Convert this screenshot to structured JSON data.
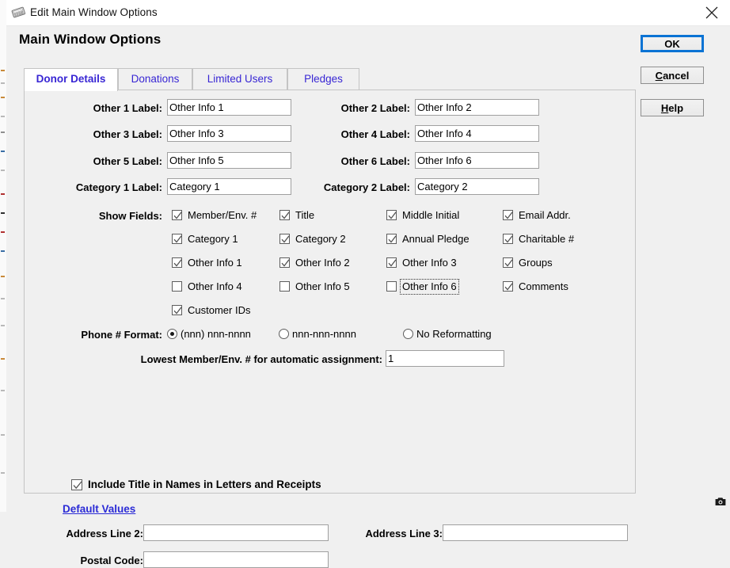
{
  "window": {
    "title": "Edit Main Window Options",
    "icon": "application-icon",
    "close_label": "✕"
  },
  "page_title": "Main Window Options",
  "buttons": [
    {
      "name": "ok-button",
      "label": "OK",
      "mnemonic": "",
      "focused": true
    },
    {
      "name": "cancel-button",
      "label": "Cancel",
      "mnemonic": "C",
      "focused": false
    },
    {
      "name": "help-button",
      "label": "Help",
      "mnemonic": "H",
      "focused": false
    }
  ],
  "tabs": [
    {
      "label": "Donor Details",
      "active": true
    },
    {
      "label": "Donations",
      "active": false
    },
    {
      "label": "Limited Users",
      "active": false
    },
    {
      "label": "Pledges",
      "active": false
    }
  ],
  "label_fields": [
    {
      "label": "Other 1 Label:",
      "value": "Other Info 1",
      "column": "left"
    },
    {
      "label": "Other 2 Label:",
      "value": "Other Info 2",
      "column": "right"
    },
    {
      "label": "Other 3 Label:",
      "value": "Other Info 3",
      "column": "left"
    },
    {
      "label": "Other 4 Label:",
      "value": "Other Info 4",
      "column": "right"
    },
    {
      "label": "Other 5 Label:",
      "value": "Other Info 5",
      "column": "left"
    },
    {
      "label": "Other 6 Label:",
      "value": "Other Info 6",
      "column": "right"
    },
    {
      "label": "Category 1 Label:",
      "value": "Category 1",
      "column": "left"
    },
    {
      "label": "Category 2 Label:",
      "value": "Category 2",
      "column": "right"
    }
  ],
  "show_fields": {
    "label": "Show Fields:",
    "items": [
      {
        "label": "Member/Env. #",
        "checked": true,
        "focused": false
      },
      {
        "label": "Title",
        "checked": true,
        "focused": false
      },
      {
        "label": "Middle Initial",
        "checked": true,
        "focused": false
      },
      {
        "label": "Email Addr.",
        "checked": true,
        "focused": false
      },
      {
        "label": "Category 1",
        "checked": true,
        "focused": false
      },
      {
        "label": "Category 2",
        "checked": true,
        "focused": false
      },
      {
        "label": "Annual Pledge",
        "checked": true,
        "focused": false
      },
      {
        "label": "Charitable #",
        "checked": true,
        "focused": false
      },
      {
        "label": "Other Info 1",
        "checked": true,
        "focused": false
      },
      {
        "label": "Other Info 2",
        "checked": true,
        "focused": false
      },
      {
        "label": "Other Info 3",
        "checked": true,
        "focused": false
      },
      {
        "label": "Groups",
        "checked": true,
        "focused": false
      },
      {
        "label": "Other Info 4",
        "checked": false,
        "focused": false
      },
      {
        "label": "Other Info 5",
        "checked": false,
        "focused": false
      },
      {
        "label": "Other Info 6",
        "checked": false,
        "focused": true
      },
      {
        "label": "Comments",
        "checked": true,
        "focused": false
      },
      {
        "label": "Customer IDs",
        "checked": true,
        "focused": false
      }
    ]
  },
  "phone_format": {
    "label": "Phone # Format:",
    "options": [
      {
        "label": "(nnn) nnn-nnnn",
        "selected": true
      },
      {
        "label": "nnn-nnn-nnnn",
        "selected": false
      },
      {
        "label": "No Reformatting",
        "selected": false
      }
    ]
  },
  "lowest_member": {
    "label": "Lowest Member/Env. # for automatic assignment:",
    "value": "1"
  },
  "include_title": {
    "label": "Include Title in Names in Letters and Receipts",
    "checked": true
  },
  "default_values_link": "Default Values",
  "address_fields": [
    {
      "label": "Address Line 2:",
      "value": "",
      "slot": "addr2"
    },
    {
      "label": "Address Line 3:",
      "value": "",
      "slot": "addr3"
    },
    {
      "label": "Postal Code:",
      "value": "",
      "slot": "postal"
    }
  ],
  "colors": {
    "window_bg": "#f0f0f0",
    "titlebar_bg": "#ffffff",
    "tab_text": "#3826d4",
    "link": "#2b2bd6",
    "focus_border": "#0a73d4",
    "field_bg": "#ffffff",
    "field_border": "#a0a0a0"
  },
  "status_icon": "camera-icon"
}
